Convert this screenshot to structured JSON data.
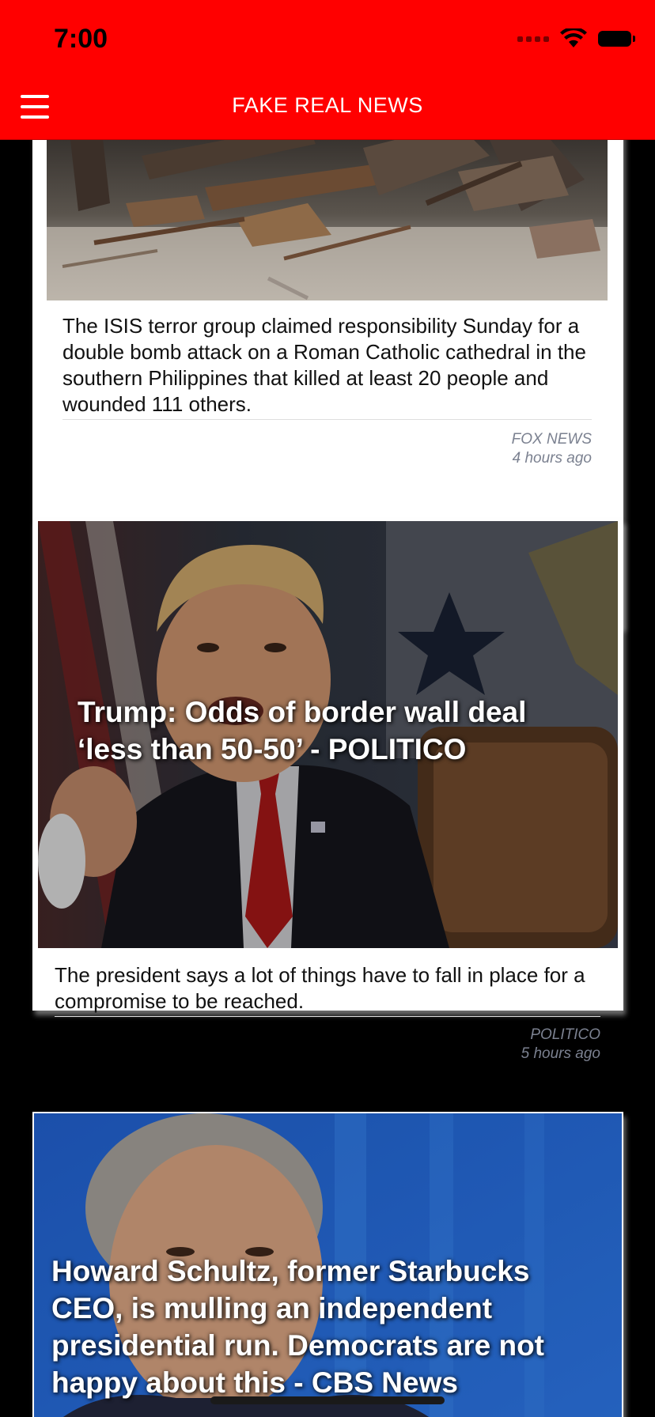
{
  "status": {
    "time": "7:00"
  },
  "header": {
    "title": "FAKE REAL NEWS"
  },
  "articles": [
    {
      "headline": "",
      "description": "The ISIS terror group claimed responsibility Sunday for a double bomb attack on a Roman Catholic cathedral in the southern Philippines that killed at least 20 people and wounded 111 others.",
      "source": "FOX NEWS",
      "time": "4 hours ago"
    },
    {
      "headline": "Trump: Odds of border wall deal ‘less than 50-50’ - POLITICO",
      "description": "The president says a lot of things have to fall in place for a compromise to be reached.",
      "source": "POLITICO",
      "time": "5 hours ago"
    },
    {
      "headline": "Howard Schultz, former Starbucks CEO, is mulling an independent presidential run. Democrats are not happy about this - CBS News",
      "description": "",
      "source": "",
      "time": ""
    }
  ]
}
